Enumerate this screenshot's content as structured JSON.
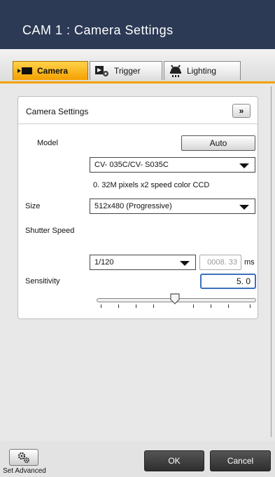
{
  "window": {
    "title": "CAM 1 : Camera Settings"
  },
  "tabs": [
    {
      "label": "Camera",
      "active": true
    },
    {
      "label": "Trigger",
      "active": false
    },
    {
      "label": "Lighting",
      "active": false
    }
  ],
  "panel": {
    "title": "Camera Settings",
    "expand_label": "»",
    "model_label": "Model",
    "auto_label": "Auto",
    "model_value": "CV- 035C/CV- S035C",
    "model_info": "0. 32M pixels x2 speed color CCD",
    "size_label": "Size",
    "size_value": "512x480 (Progressive)",
    "shutter_label": "Shutter Speed",
    "shutter_value": "1/120",
    "shutter_ms_value": "0008. 33",
    "shutter_unit": "ms",
    "sensitivity_label": "Sensitivity",
    "sensitivity_value": "5. 0"
  },
  "footer": {
    "advanced_label": "Set Advanced",
    "ok_label": "OK",
    "cancel_label": "Cancel"
  },
  "colors": {
    "titlebar": "#2c3a55",
    "active_tab": "#f5a000",
    "focus_border": "#3d6fbf"
  }
}
